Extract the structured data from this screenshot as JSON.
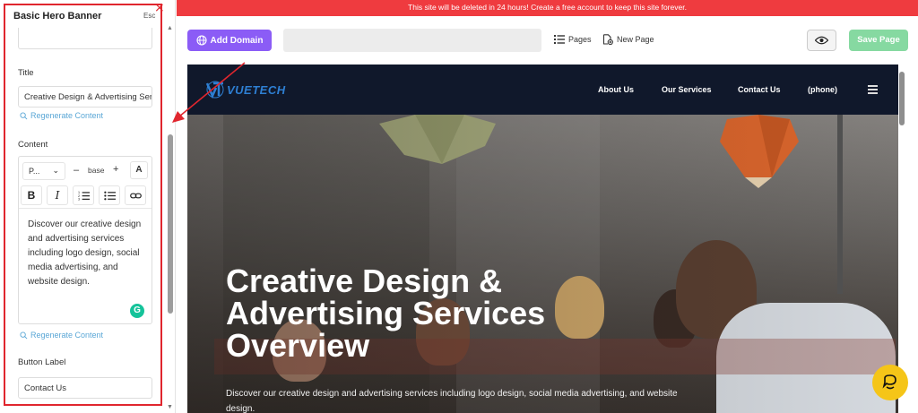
{
  "panel": {
    "title": "Basic Hero Banner",
    "esc_label": "Esc",
    "close_glyph": "×",
    "fields": {
      "title_label": "Title",
      "title_value": "Creative Design & Advertising Services Overview",
      "regenerate_label": "Regenerate Content",
      "content_label": "Content",
      "content_text": "Discover our creative design and advertising services including logo design, social media advertising, and website design.",
      "button_label_label": "Button Label",
      "button_label_value": "Contact Us"
    },
    "editor_toolbar": {
      "paragraph_select": "P...",
      "minus": "–",
      "size": "base",
      "plus": "+",
      "font_glyph": "A",
      "bold": "B",
      "italic": "I"
    },
    "grammarly_glyph": "G"
  },
  "banner": {
    "text": "This site will be deleted in 24 hours! Create a free account to keep this site forever.",
    "color": "#ef3b3f"
  },
  "toolbar": {
    "add_domain": "Add Domain",
    "pages": "Pages",
    "new_page": "New Page",
    "save_page": "Save Page",
    "accent": "#8b5cf6",
    "save_color": "#86d9a1"
  },
  "site": {
    "logo_text": "VUETECH",
    "nav": [
      "About Us",
      "Our Services",
      "Contact Us",
      "(phone)"
    ],
    "hero_title": "Creative Design & Advertising Services Overview",
    "hero_subtitle": "Discover our creative design and advertising services including logo design, social media advertising, and website design."
  },
  "icons": {
    "globe": "globe-icon",
    "pages": "list-icon",
    "new_page": "new-page-icon",
    "preview": "eye-icon",
    "menu": "hamburger-icon",
    "chat": "chat-icon",
    "regenerate": "regenerate-icon"
  }
}
